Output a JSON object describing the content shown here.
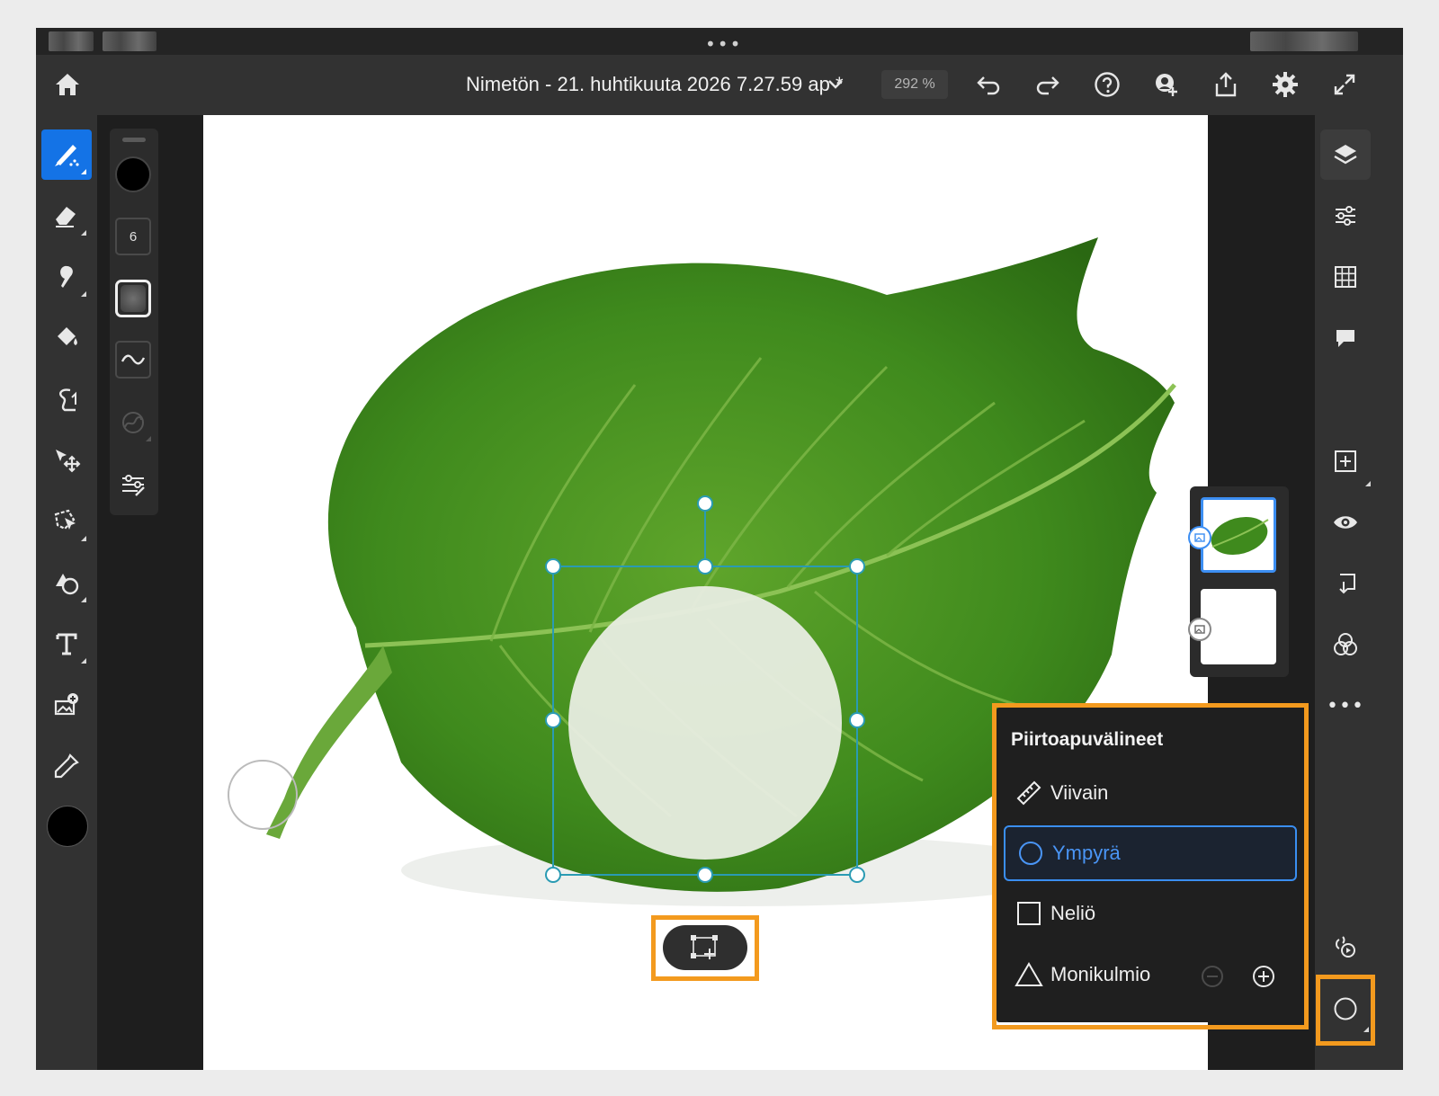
{
  "top_bar": {
    "document_title": "Nimetön - 21. huhtikuuta 2026 7.27.59 ap *",
    "zoom": "292 %"
  },
  "property_bar": {
    "brush_size": "6"
  },
  "drawing_aids_popup": {
    "title": "Piirtoapuvälineet",
    "items": [
      {
        "label": "Viivain",
        "icon": "ruler-icon",
        "selected": false
      },
      {
        "label": "Ympyrä",
        "icon": "circle-icon",
        "selected": true
      },
      {
        "label": "Neliö",
        "icon": "square-icon",
        "selected": false
      },
      {
        "label": "Monikulmio",
        "icon": "triangle-icon",
        "selected": false
      }
    ]
  },
  "colors": {
    "accent": "#1473e6",
    "highlight": "#f39a1e",
    "selection": "#3a8ef0",
    "foreground_color": "#000000"
  },
  "layers": [
    {
      "name": "leaf-image-layer",
      "selected": true
    },
    {
      "name": "white-background-layer",
      "selected": false
    }
  ]
}
